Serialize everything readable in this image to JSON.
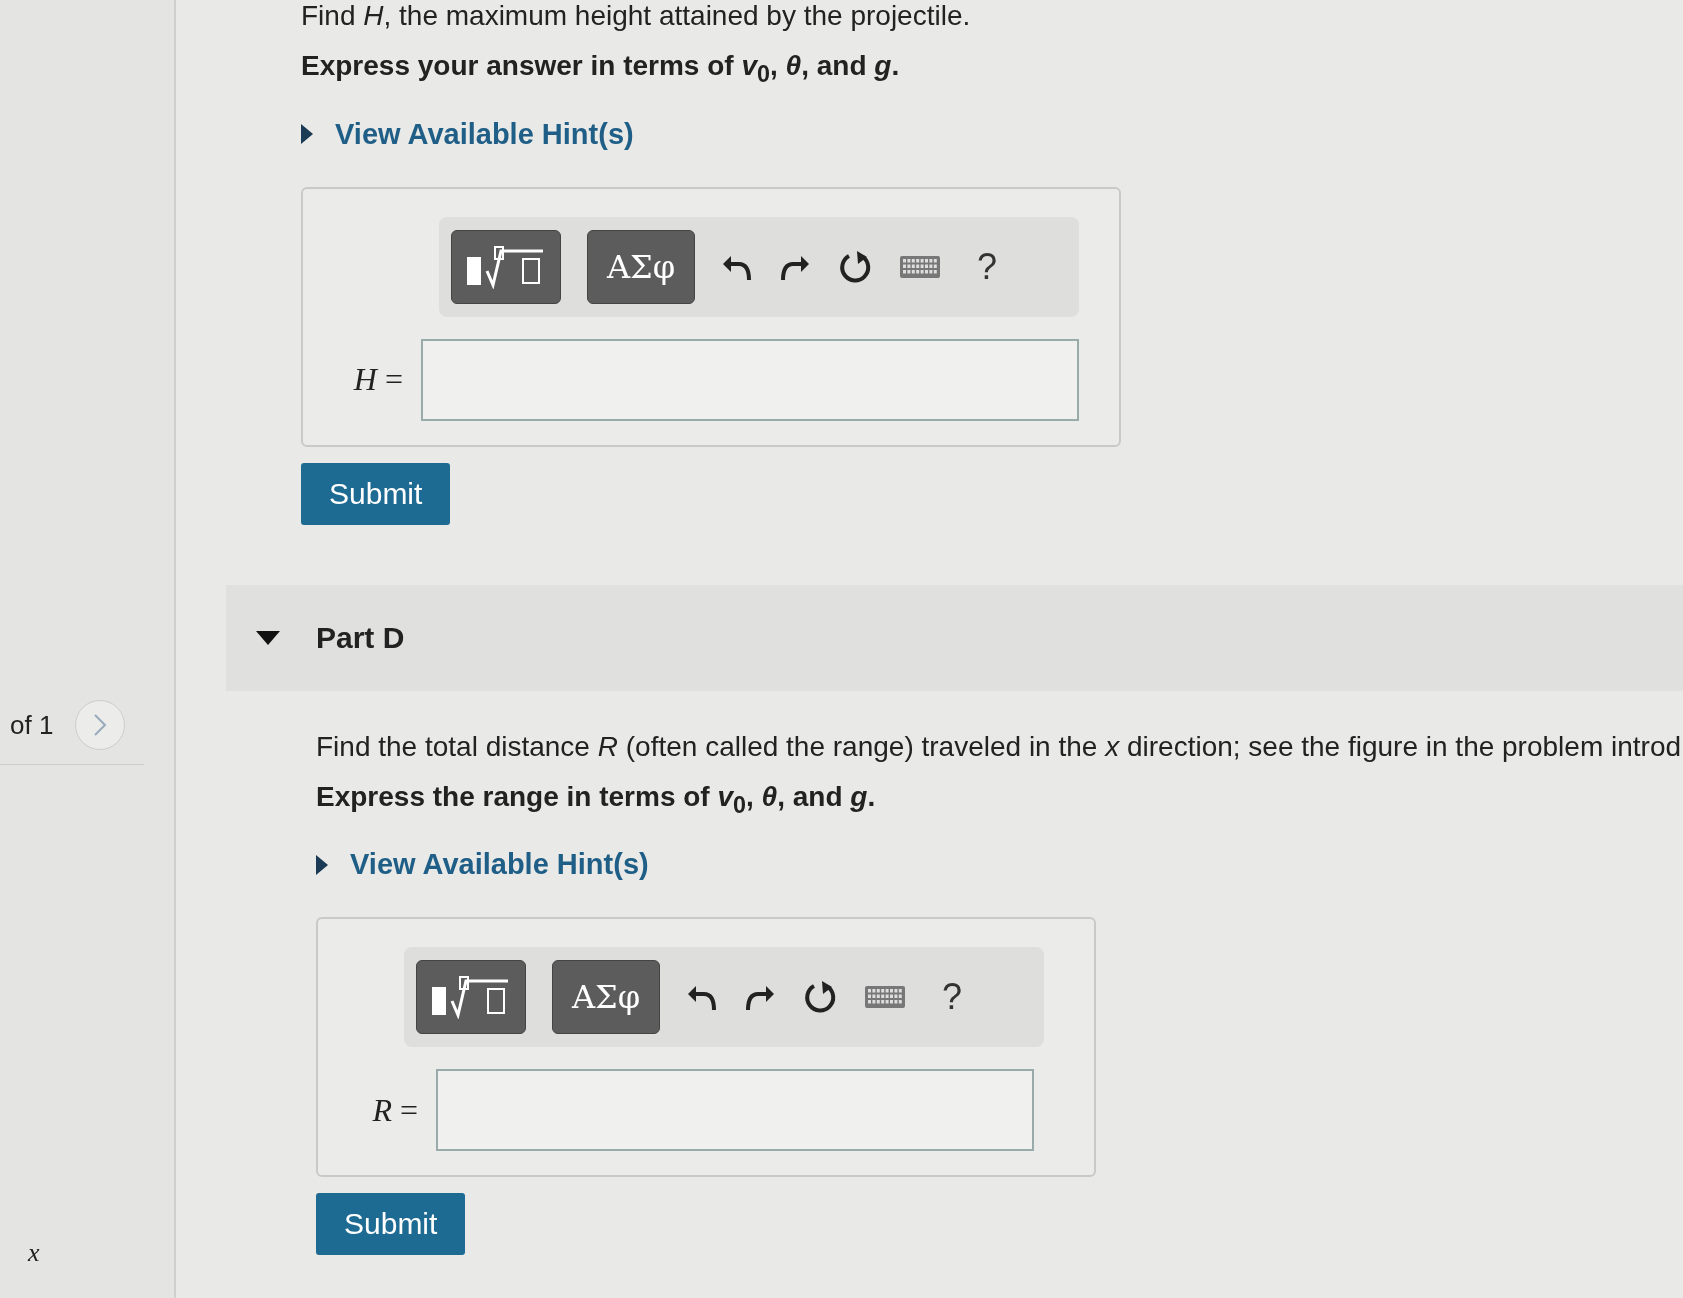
{
  "sidebar": {
    "pager": "of 1",
    "axis_label": "x"
  },
  "parts": [
    {
      "prompt": "Find *H*, the maximum height attained by the projectile.",
      "instruction": "Express your answer in terms of *v*$_{0}$, *θ*, and *g*.",
      "hint_link": "View Available Hint(s)",
      "hint_expanded": false,
      "toolbar": {
        "greek": "ΑΣφ",
        "help": "?"
      },
      "answer_label": "*H* =",
      "submit": "Submit"
    },
    {
      "title": "Part D",
      "expanded": true,
      "prompt": "Find the total distance *R* (often called the range) traveled in the *x* direction; see the figure in the problem introd",
      "instruction": "Express the range in terms of *v*$_{0}$, *θ*, and *g*.",
      "hint_link": "View Available Hint(s)",
      "hint_expanded": false,
      "toolbar": {
        "greek": "ΑΣφ",
        "help": "?"
      },
      "answer_label": "*R* =",
      "submit": "Submit"
    }
  ]
}
